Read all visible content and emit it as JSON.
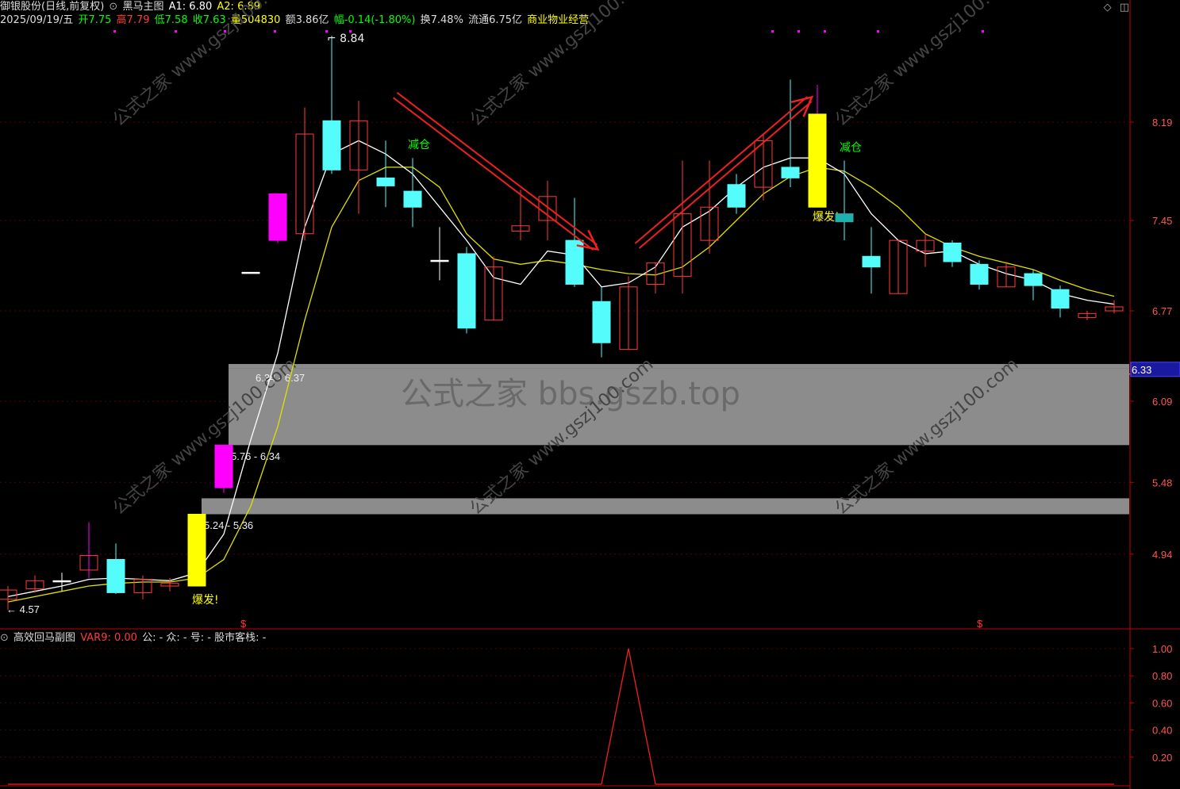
{
  "header": {
    "stock_name": "御银股份(日线,前复权)",
    "indicator_name": "黑马主图",
    "a1": "A1: 6.80",
    "a2": "A2: 6.89",
    "date": "2025/09/19/五",
    "open": "开7.75",
    "high": "高7.79",
    "low": "低7.58",
    "close": "收7.63",
    "volume": "量504830",
    "amount": "额3.86亿",
    "change": "幅-0.14(-1.80%)",
    "turnover": "换7.48%",
    "float": "流通6.75亿",
    "sector": "商业物业经营"
  },
  "sub_header": {
    "indicator_name": "高效回马副图",
    "var9": "VAR9: 0.00",
    "labels": "公: -  众: -  号: -  股市客栈: -"
  },
  "colors": {
    "up": "#ff3b3b",
    "down_fill": "#54fcfc",
    "breakout": "#ffff00",
    "strong": "#ff00ff",
    "ma5": "#ffffff",
    "ma10": "#e0e000",
    "zone": "#8c8c8c",
    "axis_red": "#c00000",
    "reduce_label": "#00ff00",
    "boom_label": "#ffff00"
  },
  "chart_data": [
    {
      "type": "candlestick",
      "y_axis_ticks": [
        "8.19",
        "7.45",
        "6.77",
        "6.09",
        "5.48",
        "4.94"
      ],
      "current_price_tag": "6.33",
      "candles": [
        {
          "o": 4.6,
          "h": 4.7,
          "l": 4.52,
          "c": 4.67,
          "color": "up"
        },
        {
          "o": 4.68,
          "h": 4.78,
          "l": 4.65,
          "c": 4.74,
          "color": "up"
        },
        {
          "o": 4.74,
          "h": 4.8,
          "l": 4.66,
          "c": 4.74,
          "color": "cross"
        },
        {
          "o": 4.82,
          "h": 5.18,
          "l": 4.76,
          "c": 4.93,
          "color": "up_thin"
        },
        {
          "o": 4.9,
          "h": 5.02,
          "l": 4.64,
          "c": 4.65,
          "color": "down"
        },
        {
          "o": 4.65,
          "h": 4.78,
          "l": 4.6,
          "c": 4.75,
          "color": "up"
        },
        {
          "o": 4.72,
          "h": 4.76,
          "l": 4.66,
          "c": 4.7,
          "color": "up"
        },
        {
          "o": 4.7,
          "h": 5.24,
          "l": 4.7,
          "c": 5.24,
          "color": "breakout",
          "label": "爆发!"
        },
        {
          "o": 5.44,
          "h": 5.76,
          "l": 5.4,
          "c": 5.76,
          "color": "strong"
        },
        {
          "o": 7.06,
          "h": 7.06,
          "l": 7.06,
          "c": 7.06,
          "color": "dash"
        },
        {
          "o": 7.3,
          "h": 7.65,
          "l": 7.28,
          "c": 7.65,
          "color": "strong"
        },
        {
          "o": 7.35,
          "h": 8.3,
          "l": 7.3,
          "c": 8.1,
          "color": "up"
        },
        {
          "o": 8.2,
          "h": 8.84,
          "l": 7.8,
          "c": 7.83,
          "color": "down",
          "label": "8.84"
        },
        {
          "o": 7.83,
          "h": 8.35,
          "l": 7.5,
          "c": 8.2,
          "color": "up"
        },
        {
          "o": 7.77,
          "h": 8.05,
          "l": 7.55,
          "c": 7.71,
          "color": "down"
        },
        {
          "o": 7.67,
          "h": 7.92,
          "l": 7.4,
          "c": 7.55,
          "color": "down",
          "label": "减仓"
        },
        {
          "o": 7.15,
          "h": 7.4,
          "l": 7.0,
          "c": 7.15,
          "color": "cross"
        },
        {
          "o": 7.2,
          "h": 7.25,
          "l": 6.6,
          "c": 6.64,
          "color": "down"
        },
        {
          "o": 6.7,
          "h": 7.18,
          "l": 6.7,
          "c": 7.1,
          "color": "up"
        },
        {
          "o": 7.37,
          "h": 7.68,
          "l": 7.3,
          "c": 7.41,
          "color": "up"
        },
        {
          "o": 7.45,
          "h": 7.75,
          "l": 7.3,
          "c": 7.63,
          "color": "up"
        },
        {
          "o": 7.3,
          "h": 7.62,
          "l": 6.95,
          "c": 6.97,
          "color": "down"
        },
        {
          "o": 6.84,
          "h": 6.95,
          "l": 6.42,
          "c": 6.53,
          "color": "down"
        },
        {
          "o": 6.48,
          "h": 7.03,
          "l": 6.48,
          "c": 6.95,
          "color": "up"
        },
        {
          "o": 6.97,
          "h": 7.13,
          "l": 6.9,
          "c": 7.13,
          "color": "up"
        },
        {
          "o": 7.03,
          "h": 7.9,
          "l": 6.9,
          "c": 7.5,
          "color": "up"
        },
        {
          "o": 7.3,
          "h": 7.9,
          "l": 7.2,
          "c": 7.55,
          "color": "up"
        },
        {
          "o": 7.72,
          "h": 7.8,
          "l": 7.5,
          "c": 7.55,
          "color": "down"
        },
        {
          "o": 7.7,
          "h": 8.1,
          "l": 7.6,
          "c": 8.05,
          "color": "up"
        },
        {
          "o": 7.85,
          "h": 8.51,
          "l": 7.7,
          "c": 7.77,
          "color": "down"
        },
        {
          "o": 8.25,
          "h": 8.47,
          "l": 7.58,
          "c": 7.55,
          "color": "breakout",
          "label": "爆发!"
        },
        {
          "o": 7.5,
          "h": 7.9,
          "l": 7.3,
          "c": 7.44,
          "color": "teal",
          "label": "减仓"
        },
        {
          "o": 7.18,
          "h": 7.4,
          "l": 6.9,
          "c": 7.1,
          "color": "down"
        },
        {
          "o": 6.9,
          "h": 7.3,
          "l": 6.9,
          "c": 7.3,
          "color": "up"
        },
        {
          "o": 7.22,
          "h": 7.35,
          "l": 7.1,
          "c": 7.3,
          "color": "up"
        },
        {
          "o": 7.28,
          "h": 7.3,
          "l": 7.1,
          "c": 7.14,
          "color": "down"
        },
        {
          "o": 7.12,
          "h": 7.15,
          "l": 6.93,
          "c": 6.97,
          "color": "down"
        },
        {
          "o": 6.95,
          "h": 7.14,
          "l": 6.95,
          "c": 7.1,
          "color": "up"
        },
        {
          "o": 7.05,
          "h": 7.08,
          "l": 6.85,
          "c": 6.96,
          "color": "down"
        },
        {
          "o": 6.93,
          "h": 6.96,
          "l": 6.72,
          "c": 6.79,
          "color": "down"
        },
        {
          "o": 6.72,
          "h": 6.77,
          "l": 6.7,
          "c": 6.75,
          "color": "up"
        },
        {
          "o": 6.8,
          "h": 6.85,
          "l": 6.75,
          "c": 6.77,
          "color": "up"
        }
      ],
      "ma5": [
        4.62,
        4.66,
        4.7,
        4.75,
        4.76,
        4.75,
        4.74,
        4.8,
        5.09,
        5.8,
        6.45,
        7.4,
        7.95,
        8.05,
        7.95,
        7.8,
        7.55,
        7.3,
        7.02,
        6.97,
        7.22,
        7.19,
        6.95,
        6.98,
        7.1,
        7.4,
        7.52,
        7.7,
        7.85,
        7.92,
        7.92,
        7.8,
        7.5,
        7.3,
        7.2,
        7.22,
        7.12,
        7.05,
        7.0,
        6.9,
        6.85,
        6.82
      ],
      "ma10": [
        4.58,
        4.62,
        4.66,
        4.7,
        4.72,
        4.73,
        4.73,
        4.76,
        4.9,
        5.3,
        5.9,
        6.7,
        7.4,
        7.75,
        7.85,
        7.85,
        7.7,
        7.35,
        7.16,
        7.12,
        7.15,
        7.12,
        7.08,
        7.05,
        7.04,
        7.1,
        7.25,
        7.45,
        7.65,
        7.78,
        7.85,
        7.82,
        7.7,
        7.55,
        7.35,
        7.25,
        7.18,
        7.13,
        7.08,
        7.0,
        6.93,
        6.88
      ],
      "zones": [
        {
          "low": 6.34,
          "high": 6.37,
          "label": "6.34 - 6.37"
        },
        {
          "low": 5.76,
          "high": 6.34,
          "label": "5.76 - 6.34"
        },
        {
          "low": 5.24,
          "high": 5.36,
          "label": "5.24 - 5.36"
        }
      ],
      "price_labels": {
        "low_marker": "4.57",
        "high_marker": "8.84"
      },
      "signal_marker": "$",
      "watermarks": [
        "公式之家 www.gszj100.com",
        "公式之家 bbs.gszb.top"
      ]
    },
    {
      "type": "line",
      "y_axis_ticks": [
        "1.00",
        "0.80",
        "0.60",
        "0.40",
        "0.20"
      ],
      "ylim": [
        0,
        1.0
      ],
      "series": [
        {
          "values": [
            0,
            0,
            0,
            0,
            0,
            0,
            0,
            0,
            0,
            0,
            0,
            0,
            0,
            0,
            0,
            0,
            0,
            0,
            0,
            0,
            0,
            0,
            0,
            1,
            0,
            0,
            0,
            0,
            0,
            0,
            0,
            0,
            0,
            0,
            0,
            0,
            0,
            0,
            0,
            0,
            0,
            0
          ]
        }
      ]
    }
  ]
}
